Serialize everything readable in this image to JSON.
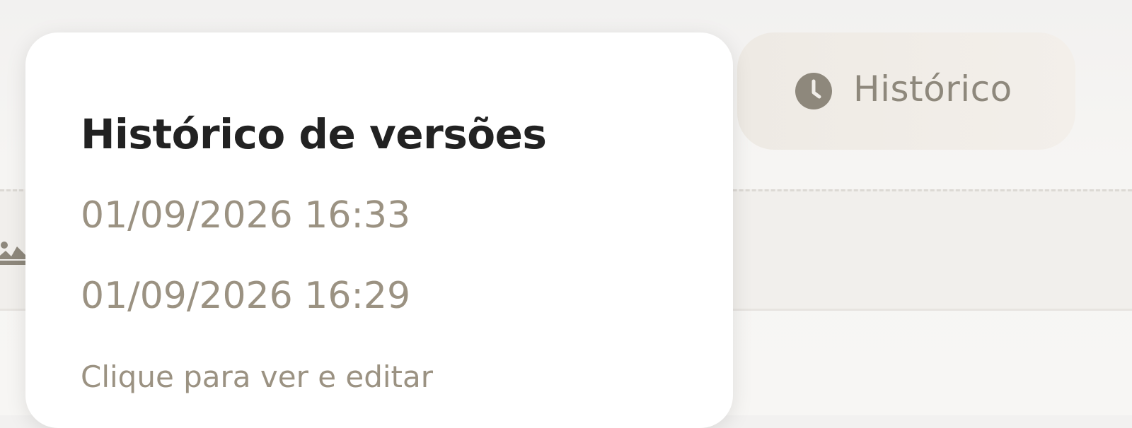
{
  "toolbar": {
    "history_button_label": "Histórico",
    "history_icon": "clock-icon"
  },
  "background": {
    "image_placeholder_icon": "image-icon"
  },
  "version_popover": {
    "title": "Histórico de versões",
    "versions": [
      {
        "timestamp": "01/09/2026 16:33"
      },
      {
        "timestamp": "01/09/2026 16:29"
      }
    ],
    "hint": "Clique para ver e editar"
  },
  "colors": {
    "title_text": "#222222",
    "muted_text": "#9b9282",
    "button_background": "#f1ede8",
    "button_text": "#8e887c",
    "popover_background": "#ffffff"
  }
}
